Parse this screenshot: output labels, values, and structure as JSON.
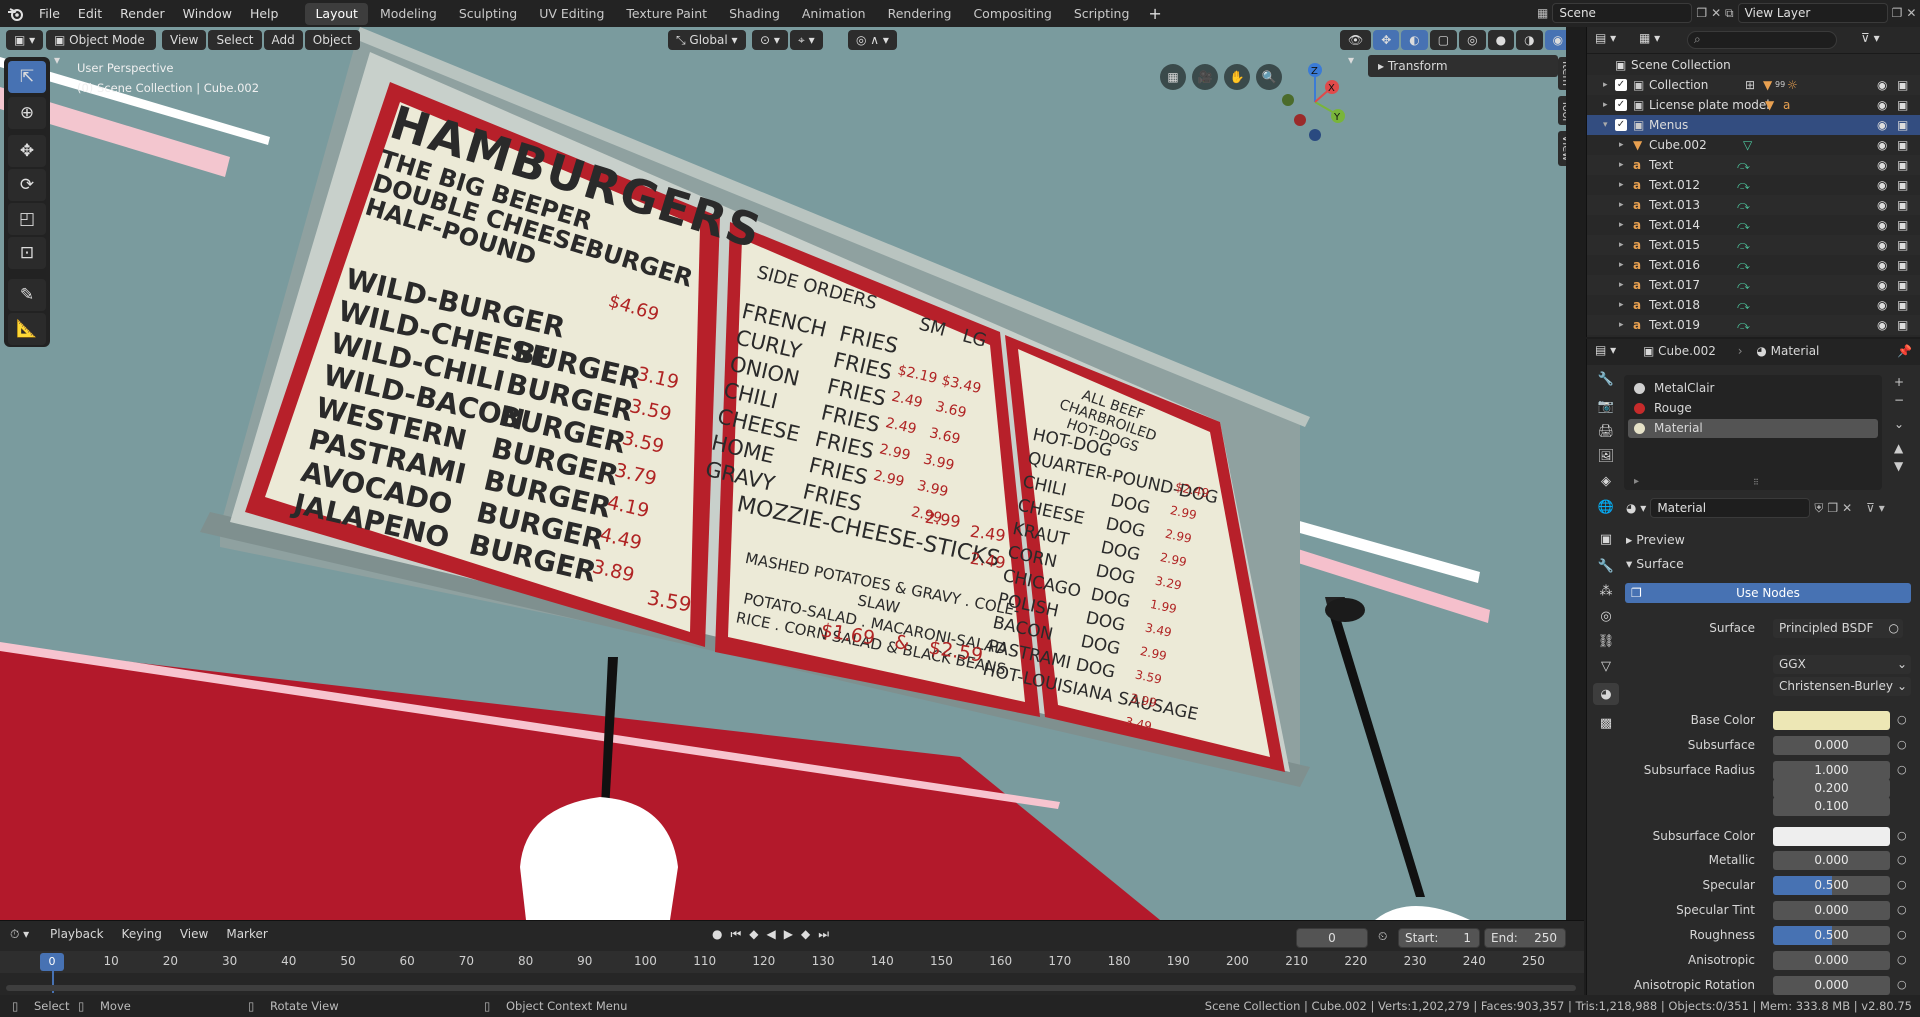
{
  "topbar": {
    "menus": [
      "File",
      "Edit",
      "Render",
      "Window",
      "Help"
    ],
    "workspaces": [
      "Layout",
      "Modeling",
      "Sculpting",
      "UV Editing",
      "Texture Paint",
      "Shading",
      "Animation",
      "Rendering",
      "Compositing",
      "Scripting"
    ],
    "active_workspace": "Layout",
    "add_tab": "+",
    "scene": "Scene",
    "view_layer": "View Layer"
  },
  "viewport": {
    "mode": "Object Mode",
    "menus": [
      "View",
      "Select",
      "Add",
      "Object"
    ],
    "orientation": "Global",
    "perspective": "User Perspective",
    "context": "(0) Scene Collection | Cube.002",
    "transform_panel": "Transform",
    "side_tabs": [
      "Item",
      "Tool",
      "View"
    ],
    "gizmo": {
      "x": "X",
      "y": "Y",
      "z": "Z"
    }
  },
  "sign": {
    "panel1": {
      "heading": "HAMBURGERS",
      "specials": [
        "THE BIG BEEPER",
        "DOUBLE CHEESEBURGER",
        "HALF-POUND"
      ],
      "special_price": "$4.69",
      "items": [
        {
          "a": "WILD-BURGER",
          "b": "",
          "p": ""
        },
        {
          "a": "WILD-CHEESE",
          "b": "BURGER",
          "p": "3.19"
        },
        {
          "a": "WILD-CHILI",
          "b": "BURGER",
          "p": "3.59"
        },
        {
          "a": "WILD-BACON",
          "b": "BURGER",
          "p": "3.59"
        },
        {
          "a": "WESTERN",
          "b": "BURGER",
          "p": "3.79"
        },
        {
          "a": "PASTRAMI",
          "b": "BURGER",
          "p": "4.19"
        },
        {
          "a": "AVOCADO",
          "b": "BURGER",
          "p": "4.49"
        },
        {
          "a": "JALAPENO",
          "b": "BURGER",
          "p": "3.89"
        }
      ],
      "last_price": "3.59"
    },
    "panel2": {
      "heading": "SIDE ORDERS",
      "col_sm": "SM",
      "col_lg": "LG",
      "items": [
        {
          "a": "FRENCH",
          "b": "FRIES",
          "sm": "",
          "lg": ""
        },
        {
          "a": "CURLY",
          "b": "FRIES",
          "sm": "$2.19",
          "lg": "$3.49"
        },
        {
          "a": "ONION",
          "b": "FRIES",
          "sm": "2.49",
          "lg": "3.69"
        },
        {
          "a": "CHILI",
          "b": "FRIES",
          "sm": "2.49",
          "lg": "3.69"
        },
        {
          "a": "CHEESE",
          "b": "FRIES",
          "sm": "2.99",
          "lg": "3.99"
        },
        {
          "a": "HOME",
          "b": "FRIES",
          "sm": "2.99",
          "lg": "3.99"
        },
        {
          "a": "GRAVY",
          "b": "FRIES",
          "sm": "",
          "lg": "2.99"
        }
      ],
      "mozzie": "MOZZIE-CHEESE-STICKS",
      "mozzie_sm": "2.99",
      "mozzie_lg": "2.49",
      "extra_lg": "2.49",
      "sides": [
        "MASHED POTATOES & GRAVY . COLE-SLAW",
        "POTATO-SALAD . MACARONI-SALAD",
        "RICE . CORN SALAD & BLACK BEANS"
      ],
      "sides_price_1": "$1.69",
      "sides_amp": "&",
      "sides_price_2": "$2.59"
    },
    "panel3": {
      "heading_1": "ALL BEEF CHARBROILED",
      "heading_2": "HOT-DOGS",
      "items": [
        {
          "a": "HOT-DOG",
          "b": "",
          "p": ""
        },
        {
          "a": "QUARTER-POUND-DOG",
          "b": "",
          "p": "$2.49"
        },
        {
          "a": "CHILI",
          "b": "DOG",
          "p": "2.99"
        },
        {
          "a": "CHEESE",
          "b": "DOG",
          "p": "2.99"
        },
        {
          "a": "KRAUT",
          "b": "DOG",
          "p": "2.99"
        },
        {
          "a": "CORN",
          "b": "DOG",
          "p": "3.29"
        },
        {
          "a": "CHICAGO",
          "b": "DOG",
          "p": "1.99"
        },
        {
          "a": "POLISH",
          "b": "DOG",
          "p": "3.49"
        },
        {
          "a": "BACON",
          "b": "DOG",
          "p": "2.99"
        },
        {
          "a": "PASTRAMI",
          "b": "DOG",
          "p": "3.59"
        },
        {
          "a": "HOT-LOUISIANA SAUSAGE",
          "b": "",
          "p": "3.99"
        }
      ],
      "last_price": "3.49"
    }
  },
  "outliner": {
    "search_placeholder": "",
    "root": "Scene Collection",
    "rows": [
      {
        "name": "Collection",
        "level": 1,
        "type": "collection"
      },
      {
        "name": "License plate model",
        "level": 1,
        "type": "collection"
      },
      {
        "name": "Menus",
        "level": 1,
        "type": "collection",
        "selected": true
      },
      {
        "name": "Cube.002",
        "level": 2,
        "type": "mesh"
      },
      {
        "name": "Text",
        "level": 2,
        "type": "text"
      },
      {
        "name": "Text.012",
        "level": 2,
        "type": "text"
      },
      {
        "name": "Text.013",
        "level": 2,
        "type": "text"
      },
      {
        "name": "Text.014",
        "level": 2,
        "type": "text"
      },
      {
        "name": "Text.015",
        "level": 2,
        "type": "text"
      },
      {
        "name": "Text.016",
        "level": 2,
        "type": "text"
      },
      {
        "name": "Text.017",
        "level": 2,
        "type": "text"
      },
      {
        "name": "Text.018",
        "level": 2,
        "type": "text"
      },
      {
        "name": "Text.019",
        "level": 2,
        "type": "text"
      }
    ],
    "collection_badge": "99"
  },
  "properties": {
    "object": "Cube.002",
    "tab": "Material",
    "slots": [
      {
        "name": "MetalClair",
        "color": "#d0d0d0"
      },
      {
        "name": "Rouge",
        "color": "#c62b2b"
      },
      {
        "name": "Material",
        "color": "#e6e2c8",
        "selected": true
      }
    ],
    "material_name": "Material",
    "preview": "Preview",
    "surface_panel": "Surface",
    "use_nodes": "Use Nodes",
    "surface_label": "Surface",
    "surface_value": "Principled BSDF",
    "distribution": "GGX",
    "subsurface_method": "Christensen-Burley",
    "fields": [
      {
        "label": "Base Color",
        "value": "",
        "color": "#ede7b5"
      },
      {
        "label": "Subsurface",
        "value": "0.000"
      },
      {
        "label": "Subsurface Radius",
        "value": "1.000"
      },
      {
        "label": "",
        "value": "0.200"
      },
      {
        "label": "",
        "value": "0.100"
      },
      {
        "label": "Subsurface Color",
        "value": "",
        "color": "#eeeeee"
      },
      {
        "label": "Metallic",
        "value": "0.000"
      },
      {
        "label": "Specular",
        "value": "0.500",
        "fill": 0.5
      },
      {
        "label": "Specular Tint",
        "value": "0.000"
      },
      {
        "label": "Roughness",
        "value": "0.500",
        "fill": 0.5
      },
      {
        "label": "Anisotropic",
        "value": "0.000"
      },
      {
        "label": "Anisotropic Rotation",
        "value": "0.000"
      }
    ]
  },
  "timeline": {
    "menus": [
      "Playback",
      "Keying",
      "View",
      "Marker"
    ],
    "current_frame": "0",
    "start_label": "Start:",
    "start": "1",
    "end_label": "End:",
    "end": "250",
    "ticks": [
      "0",
      "10",
      "20",
      "30",
      "40",
      "50",
      "60",
      "70",
      "80",
      "90",
      "100",
      "110",
      "120",
      "130",
      "140",
      "150",
      "160",
      "170",
      "180",
      "190",
      "200",
      "210",
      "220",
      "230",
      "240",
      "250"
    ],
    "frame_marker": "0"
  },
  "status": {
    "select": "Select",
    "move": "Move",
    "rotate": "Rotate View",
    "context_menu": "Object Context Menu",
    "stats": "Scene Collection | Cube.002 | Verts:1,202,279 | Faces:903,357 | Tris:1,218,988 | Objects:0/351 | Mem: 333.8 MB | v2.80.75"
  }
}
